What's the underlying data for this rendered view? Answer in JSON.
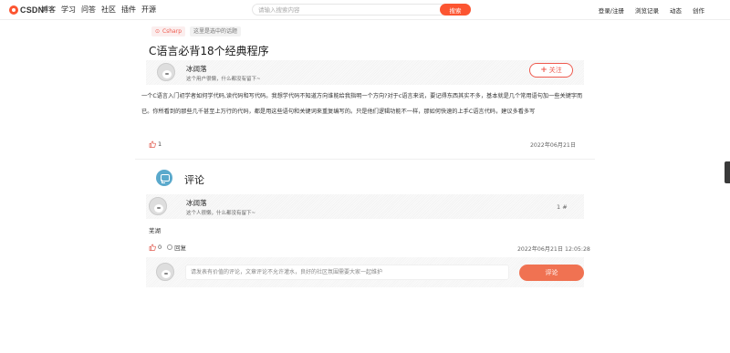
{
  "header": {
    "logo_text": "CSDN",
    "nav": [
      "博客",
      "学习",
      "问答",
      "社区",
      "插件",
      "开源"
    ],
    "search_placeholder": "请输入搜索内容",
    "search_button": "搜索",
    "right_nav": [
      "登录/注册",
      "浏览记录",
      "动态",
      "创作"
    ]
  },
  "tags": {
    "csharp": "Csharp",
    "topic": "这里是选中的话题"
  },
  "article": {
    "title": "C语言必背18个经典程序",
    "author": {
      "name": "冰阔落",
      "desc": "这个用户很懒，什么都没有留下~"
    },
    "follow_label": "关注",
    "body": "一个C语言入门初学者如何学代码,读代码和写代码。我想学代码不知道方向谁能给我指明一个方向?对于c语言来说，要记得东西其实不多，基本就是几个常用语句加一些关键字而已。你所看到的那些几千甚至上万行的代码，都是用这些语句和关键词来重复编写的。只是他们逻辑功能不一样，那如何快速的上手C语言代码，建议多看多写",
    "likes": "1",
    "date": "2022年06月21日"
  },
  "comments": {
    "heading": "评论",
    "items": [
      {
        "author": "冰阔落",
        "desc": "这个人很懒，什么都没有留下~",
        "floor": "1 #",
        "text": "芜湖",
        "likes": "0",
        "reply_label": "回复",
        "date": "2022年06月21日 12:05:28"
      }
    ],
    "compose_placeholder": "请发表有价值的评论，文章评论不允许灌水，良好的社区氛围需要大家一起维护",
    "submit_label": "评论"
  },
  "colors": {
    "accent": "#fc5531",
    "follow": "#ee5a4e",
    "submit": "#f07252",
    "comment_icon": "#5aa9cc"
  },
  "icons": [
    "csdn-logo-icon",
    "plus-icon",
    "thumb-up-icon",
    "comment-bubble-icon",
    "reply-icon",
    "avatar-icon"
  ]
}
